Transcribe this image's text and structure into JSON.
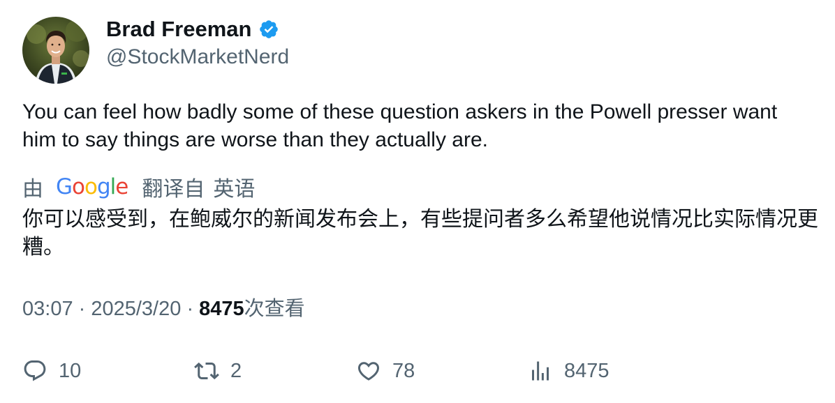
{
  "author": {
    "display_name": "Brad Freeman",
    "handle": "@StockMarketNerd",
    "verified": true,
    "verified_color": "#1d9bf0"
  },
  "tweet": {
    "text": "You can feel how badly some of these question askers in the Powell presser want him to say things are worse than they actually are."
  },
  "translation": {
    "by_label": "由",
    "provider": "Google",
    "from_label": "翻译自",
    "language": "英语",
    "text": "你可以感受到，在鲍威尔的新闻发布会上，有些提问者多么希望他说情况比实际情况更糟。"
  },
  "meta": {
    "time": "03:07",
    "separator": "·",
    "date": "2025/3/20",
    "views_count": "8475",
    "views_label": "次查看"
  },
  "actions": {
    "replies": "10",
    "retweets": "2",
    "likes": "78",
    "views": "8475"
  },
  "colors": {
    "text_primary": "#0f1419",
    "text_secondary": "#536471",
    "google_blue": "#4285F4",
    "google_red": "#EA4335",
    "google_yellow": "#FBBC05",
    "google_green": "#34A853"
  }
}
